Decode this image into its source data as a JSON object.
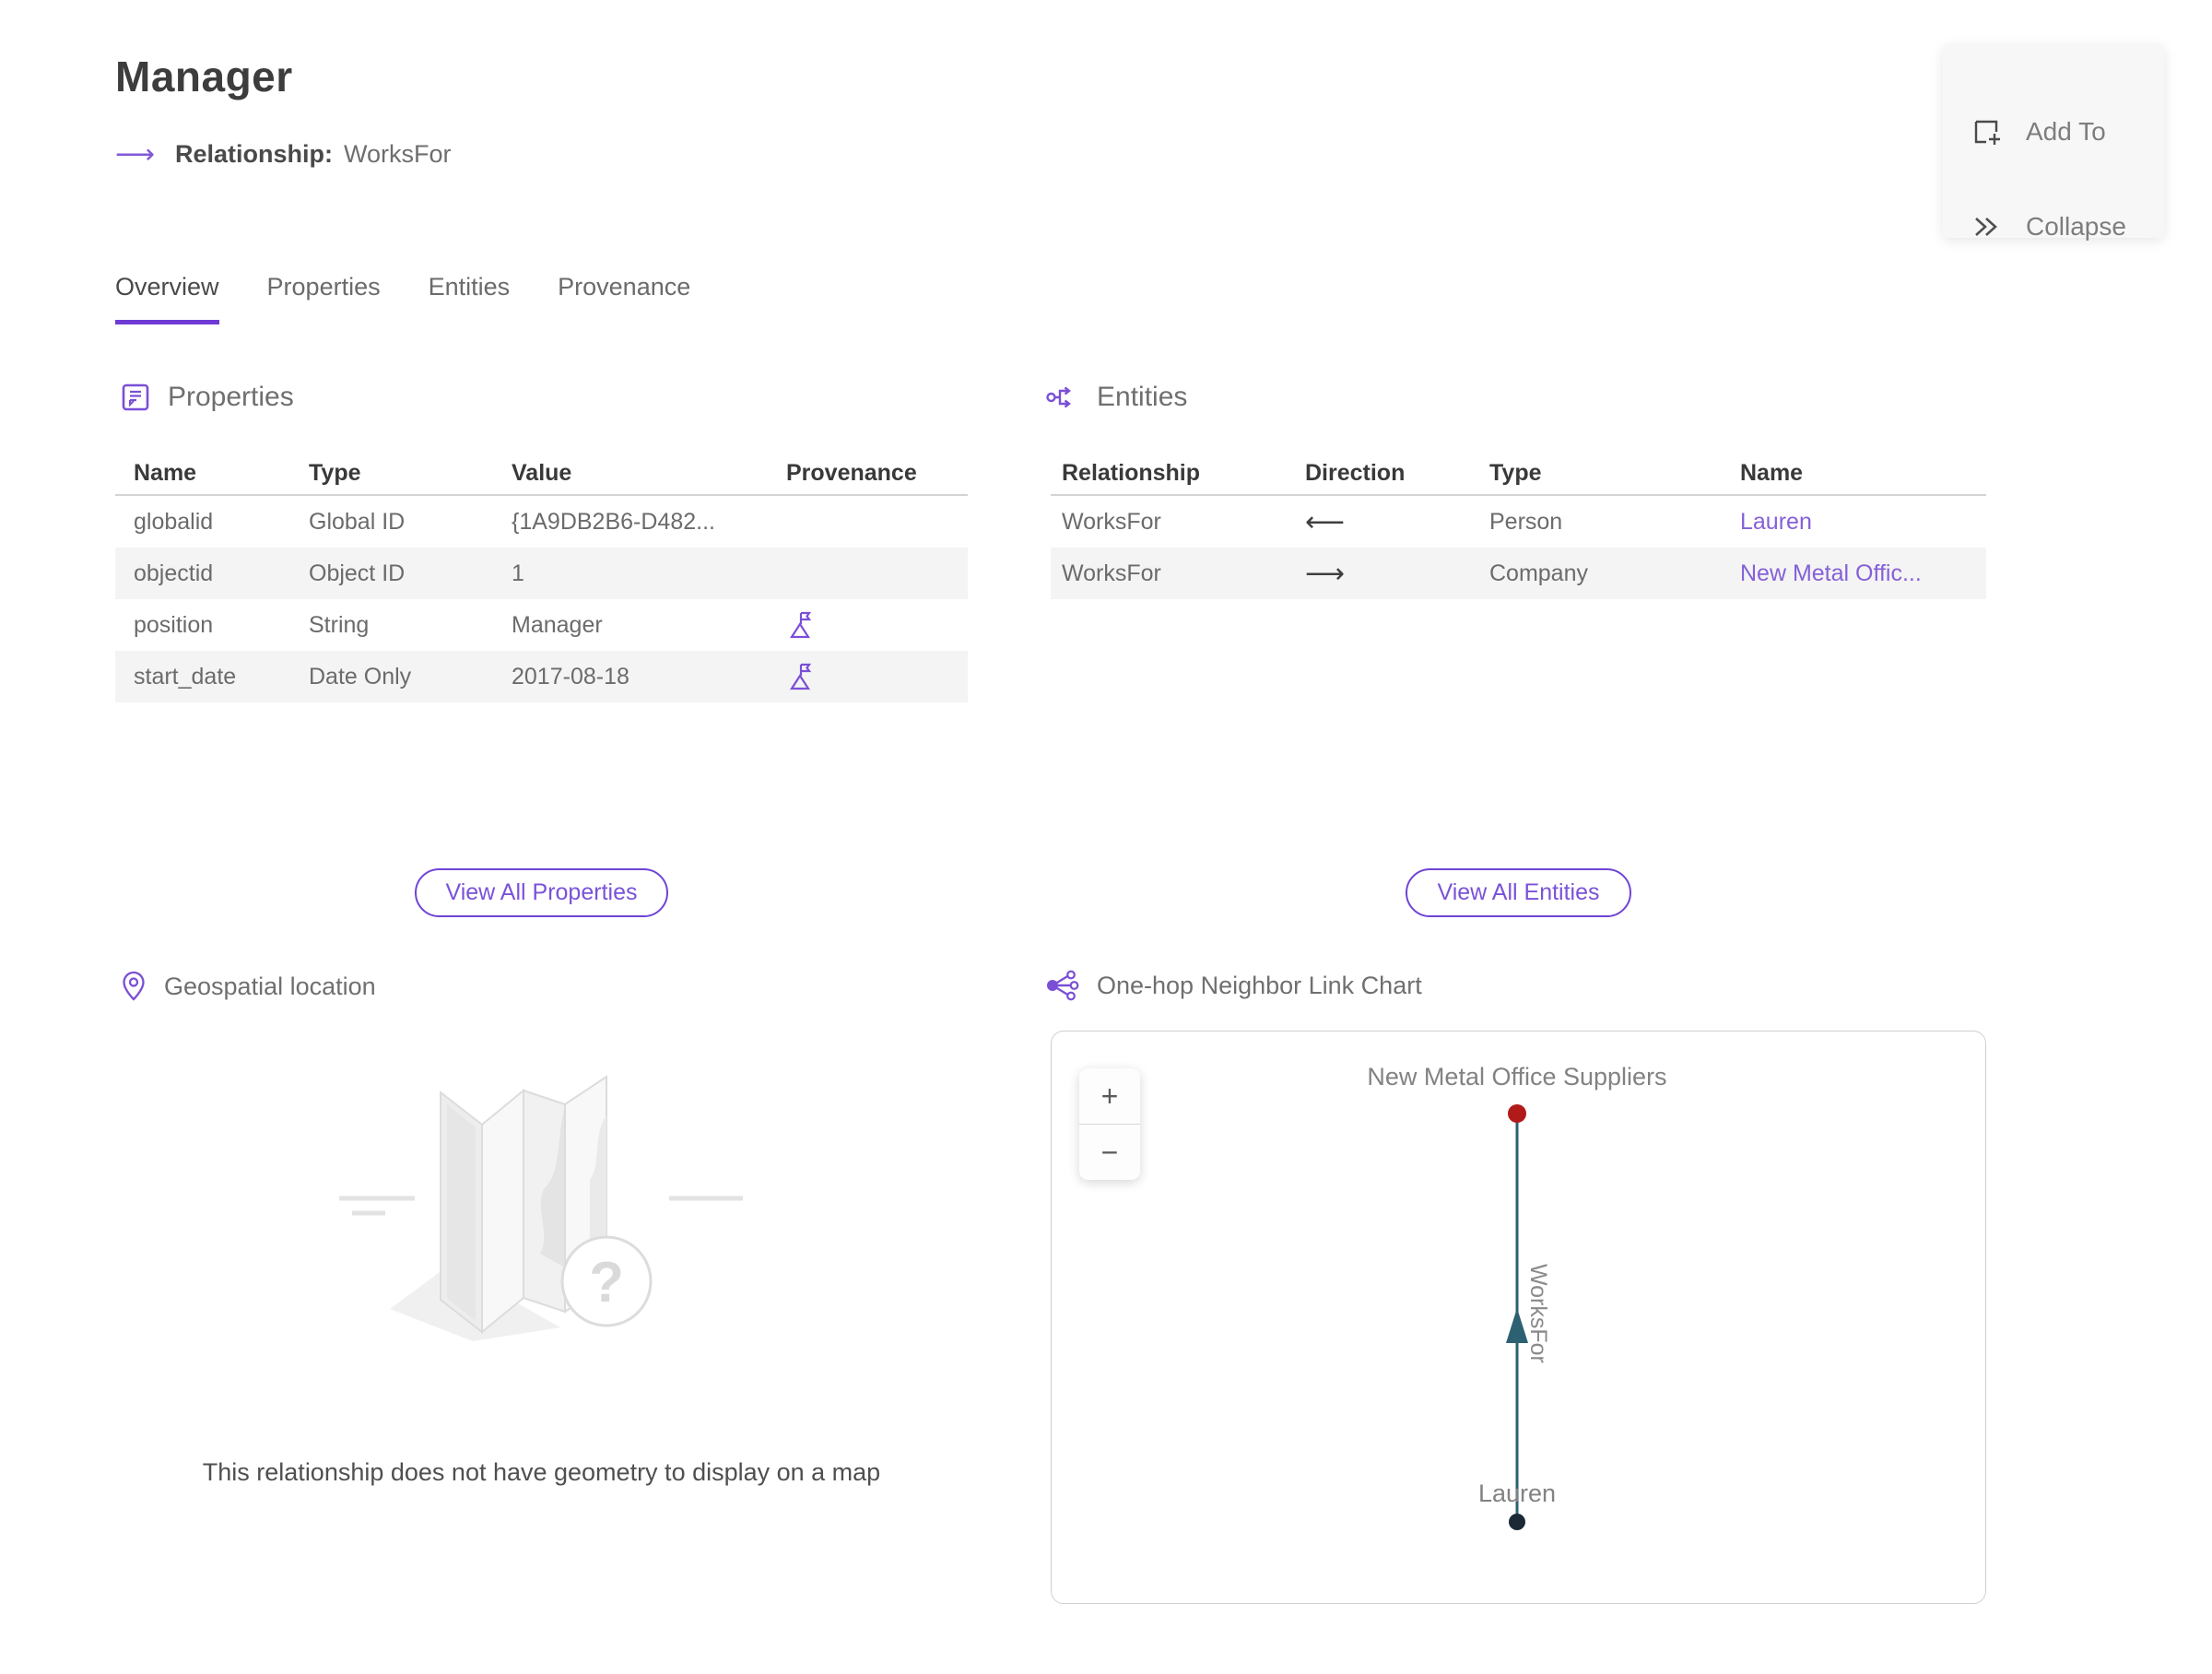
{
  "header": {
    "title": "Manager",
    "subtitle_label": "Relationship:",
    "subtitle_value": "WorksFor"
  },
  "actions": {
    "add_to": "Add To",
    "collapse": "Collapse"
  },
  "tabs": [
    {
      "label": "Overview",
      "active": true
    },
    {
      "label": "Properties",
      "active": false
    },
    {
      "label": "Entities",
      "active": false
    },
    {
      "label": "Provenance",
      "active": false
    }
  ],
  "properties_section": {
    "title": "Properties",
    "columns": {
      "name": "Name",
      "type": "Type",
      "value": "Value",
      "provenance": "Provenance"
    },
    "rows": [
      {
        "name": "globalid",
        "type": "Global ID",
        "value": "{1A9DB2B6-D482...",
        "has_provenance": false
      },
      {
        "name": "objectid",
        "type": "Object ID",
        "value": "1",
        "has_provenance": false
      },
      {
        "name": "position",
        "type": "String",
        "value": "Manager",
        "has_provenance": true
      },
      {
        "name": "start_date",
        "type": "Date Only",
        "value": "2017-08-18",
        "has_provenance": true
      }
    ],
    "view_all_label": "View All Properties"
  },
  "entities_section": {
    "title": "Entities",
    "columns": {
      "relationship": "Relationship",
      "direction": "Direction",
      "type": "Type",
      "name": "Name"
    },
    "rows": [
      {
        "relationship": "WorksFor",
        "direction": "⟵",
        "type": "Person",
        "name": "Lauren"
      },
      {
        "relationship": "WorksFor",
        "direction": "⟶",
        "type": "Company",
        "name": "New Metal Offic..."
      }
    ],
    "view_all_label": "View All Entities"
  },
  "geospatial_section": {
    "title": "Geospatial location",
    "empty_message": "This relationship does not have geometry to display on a map",
    "placeholder_glyph": "?"
  },
  "link_chart_section": {
    "title": "One-hop Neighbor Link Chart",
    "zoom_in": "+",
    "zoom_out": "−",
    "graph": {
      "top_node_label": "New Metal Office Suppliers",
      "bottom_node_label": "Lauren",
      "edge_label": "WorksFor",
      "top_node_color": "#b11a18",
      "bottom_node_color": "#1b2836",
      "edge_color": "#2c6172"
    }
  },
  "colors": {
    "accent_purple": "#7a4fd6",
    "link_purple": "#8560d8",
    "tab_underline": "#6f3bd4"
  }
}
